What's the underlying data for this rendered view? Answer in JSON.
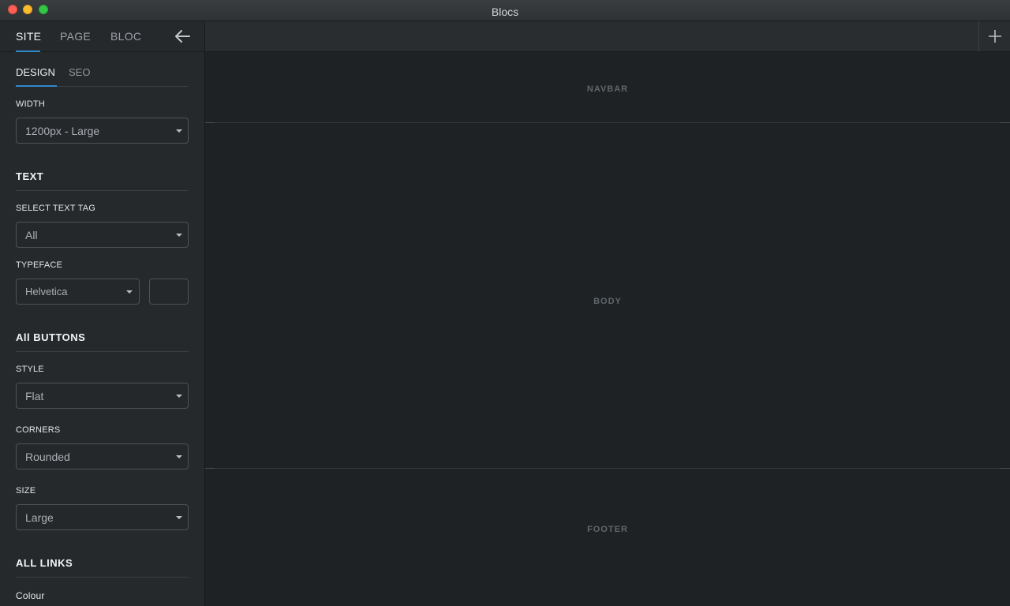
{
  "window": {
    "title": "Blocs"
  },
  "sidebar": {
    "tabs": [
      "SITE",
      "PAGE",
      "BLOC"
    ],
    "subtabs": [
      "DESIGN",
      "SEO"
    ],
    "width": {
      "label": "WIDTH",
      "value": "1200px - Large"
    },
    "text_section": {
      "heading": "TEXT",
      "select_tag_label": "SELECT TEXT TAG",
      "select_tag_value": "All",
      "typeface_label": "TYPEFACE",
      "typeface_value": "Helvetica"
    },
    "buttons_section": {
      "heading": "All BUTTONS",
      "style_label": "STYLE",
      "style_value": "Flat",
      "corners_label": "CORNERS",
      "corners_value": "Rounded",
      "size_label": "SIZE",
      "size_value": "Large"
    },
    "links_section": {
      "heading": "ALL LINKS",
      "colour_label": "Colour"
    }
  },
  "canvas": {
    "regions": [
      "NAVBAR",
      "BODY",
      "FOOTER"
    ]
  }
}
